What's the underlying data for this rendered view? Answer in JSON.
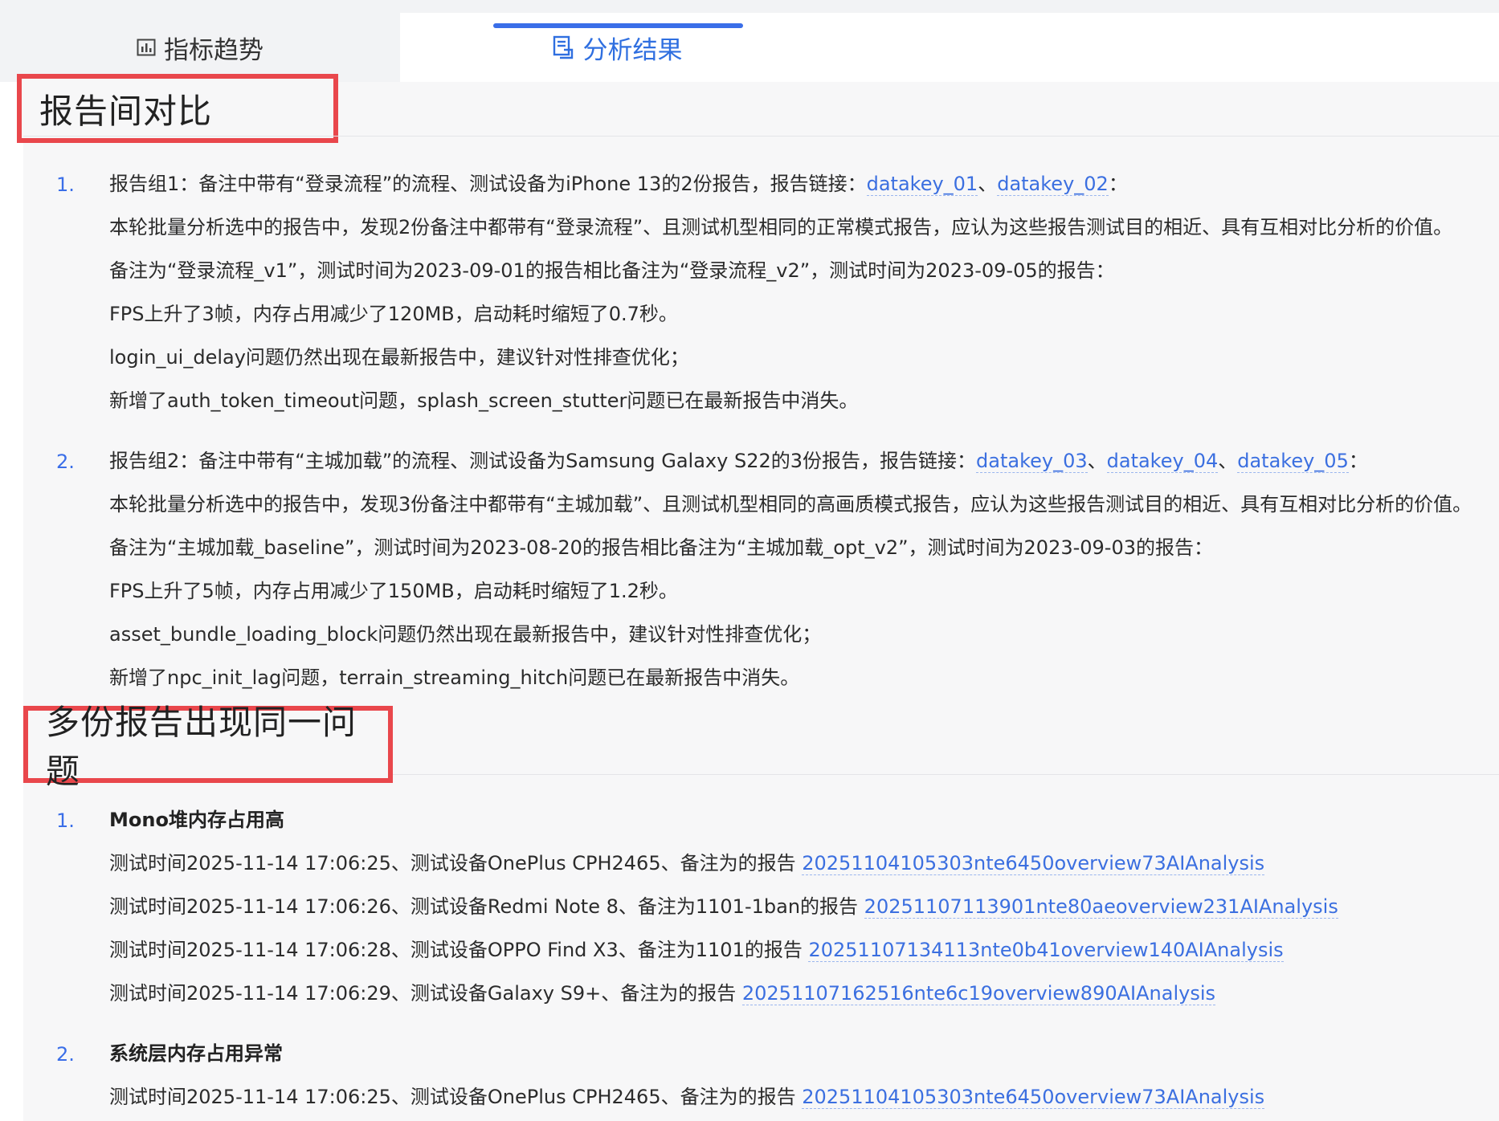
{
  "tabs": {
    "trend_label": "指标趋势",
    "analysis_label": "分析结果"
  },
  "section1": {
    "title": "报告间对比",
    "groups": [
      {
        "num": "1.",
        "head_prefix": "报告组1：备注中带有“登录流程”的流程、测试设备为iPhone 13的2份报告，报告链接：",
        "links": [
          "datakey_01",
          "datakey_02"
        ],
        "sep": "、",
        "end": "：",
        "lines": [
          "本轮批量分析选中的报告中，发现2份备注中都带有“登录流程”、且测试机型相同的正常模式报告，应认为这些报告测试目的相近、具有互相对比分析的价值。",
          "备注为“登录流程_v1”，测试时间为2023-09-01的报告相比备注为“登录流程_v2”，测试时间为2023-09-05的报告：",
          "FPS上升了3帧，内存占用减少了120MB，启动耗时缩短了0.7秒。",
          "login_ui_delay问题仍然出现在最新报告中，建议针对性排查优化；",
          "新增了auth_token_timeout问题，splash_screen_stutter问题已在最新报告中消失。"
        ]
      },
      {
        "num": "2.",
        "head_prefix": "报告组2：备注中带有“主城加载”的流程、测试设备为Samsung Galaxy S22的3份报告，报告链接：",
        "links": [
          "datakey_03",
          "datakey_04",
          "datakey_05"
        ],
        "sep": "、",
        "end": "：",
        "lines": [
          "本轮批量分析选中的报告中，发现3份备注中都带有“主城加载”、且测试机型相同的高画质模式报告，应认为这些报告测试目的相近、具有互相对比分析的价值。",
          "备注为“主城加载_baseline”，测试时间为2023-08-20的报告相比备注为“主城加载_opt_v2”，测试时间为2023-09-03的报告：",
          "FPS上升了5帧，内存占用减少了150MB，启动耗时缩短了1.2秒。",
          "asset_bundle_loading_block问题仍然出现在最新报告中，建议针对性排查优化；",
          "新增了npc_init_lag问题，terrain_streaming_hitch问题已在最新报告中消失。"
        ]
      }
    ]
  },
  "section2": {
    "title": "多份报告出现同一问题",
    "issues": [
      {
        "num": "1.",
        "name": "Mono堆内存占用高",
        "rows": [
          {
            "text": "测试时间2025-11-14 17:06:25、测试设备OnePlus CPH2465、备注为的报告 ",
            "link": "20251104105303nte6450overview73AIAnalysis"
          },
          {
            "text": "测试时间2025-11-14 17:06:26、测试设备Redmi Note 8、备注为1101-1ban的报告 ",
            "link": "20251107113901nte80aeoverview231AIAnalysis"
          },
          {
            "text": "测试时间2025-11-14 17:06:28、测试设备OPPO Find X3、备注为1101的报告 ",
            "link": "20251107134113nte0b41overview140AIAnalysis"
          },
          {
            "text": "测试时间2025-11-14 17:06:29、测试设备Galaxy S9+、备注为的报告 ",
            "link": "20251107162516nte6c19overview890AIAnalysis"
          }
        ]
      },
      {
        "num": "2.",
        "name": "系统层内存占用异常",
        "rows": [
          {
            "text": "测试时间2025-11-14 17:06:25、测试设备OnePlus CPH2465、备注为的报告 ",
            "link": "20251104105303nte6450overview73AIAnalysis"
          }
        ]
      }
    ]
  }
}
